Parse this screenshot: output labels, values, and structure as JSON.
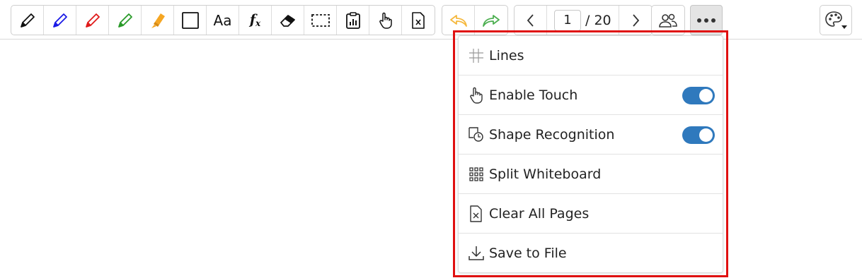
{
  "toolbar": {
    "tools": [
      {
        "name": "pencil-black-icon",
        "color": "#111111"
      },
      {
        "name": "pencil-blue-icon",
        "color": "#1a1ae6"
      },
      {
        "name": "pencil-red-icon",
        "color": "#e01a1a"
      },
      {
        "name": "pencil-green-icon",
        "color": "#2a9a2a"
      },
      {
        "name": "highlighter-icon",
        "color": "#f5a623"
      },
      {
        "name": "rectangle-icon"
      },
      {
        "name": "text-icon",
        "label": "Aa"
      },
      {
        "name": "formula-icon",
        "label": "f",
        "sub": "x"
      },
      {
        "name": "eraser-icon"
      },
      {
        "name": "select-area-icon"
      },
      {
        "name": "clipboard-chart-icon"
      },
      {
        "name": "hand-pointer-icon"
      },
      {
        "name": "clear-page-icon"
      }
    ],
    "undo_icon": "undo-icon",
    "redo_icon": "redo-icon",
    "undo_color": "#f5b83d",
    "redo_color": "#4caf50",
    "page": {
      "current": "1",
      "total_text": "/ 20"
    },
    "users_icon": "users-icon",
    "more_icon": "more-dots-icon",
    "palette_icon": "palette-icon"
  },
  "menu": {
    "items": [
      {
        "label": "Lines",
        "icon": "grid-lines-icon"
      },
      {
        "label": "Enable Touch",
        "icon": "touch-hand-icon",
        "toggle": true
      },
      {
        "label": "Shape Recognition",
        "icon": "shape-recognition-icon",
        "toggle": true
      },
      {
        "label": "Split Whiteboard",
        "icon": "split-grid-icon"
      },
      {
        "label": "Clear All Pages",
        "icon": "clear-all-icon"
      },
      {
        "label": "Save to File",
        "icon": "download-icon"
      }
    ]
  },
  "colors": {
    "accent": "#2f79bd",
    "highlight_border": "#e01010"
  }
}
